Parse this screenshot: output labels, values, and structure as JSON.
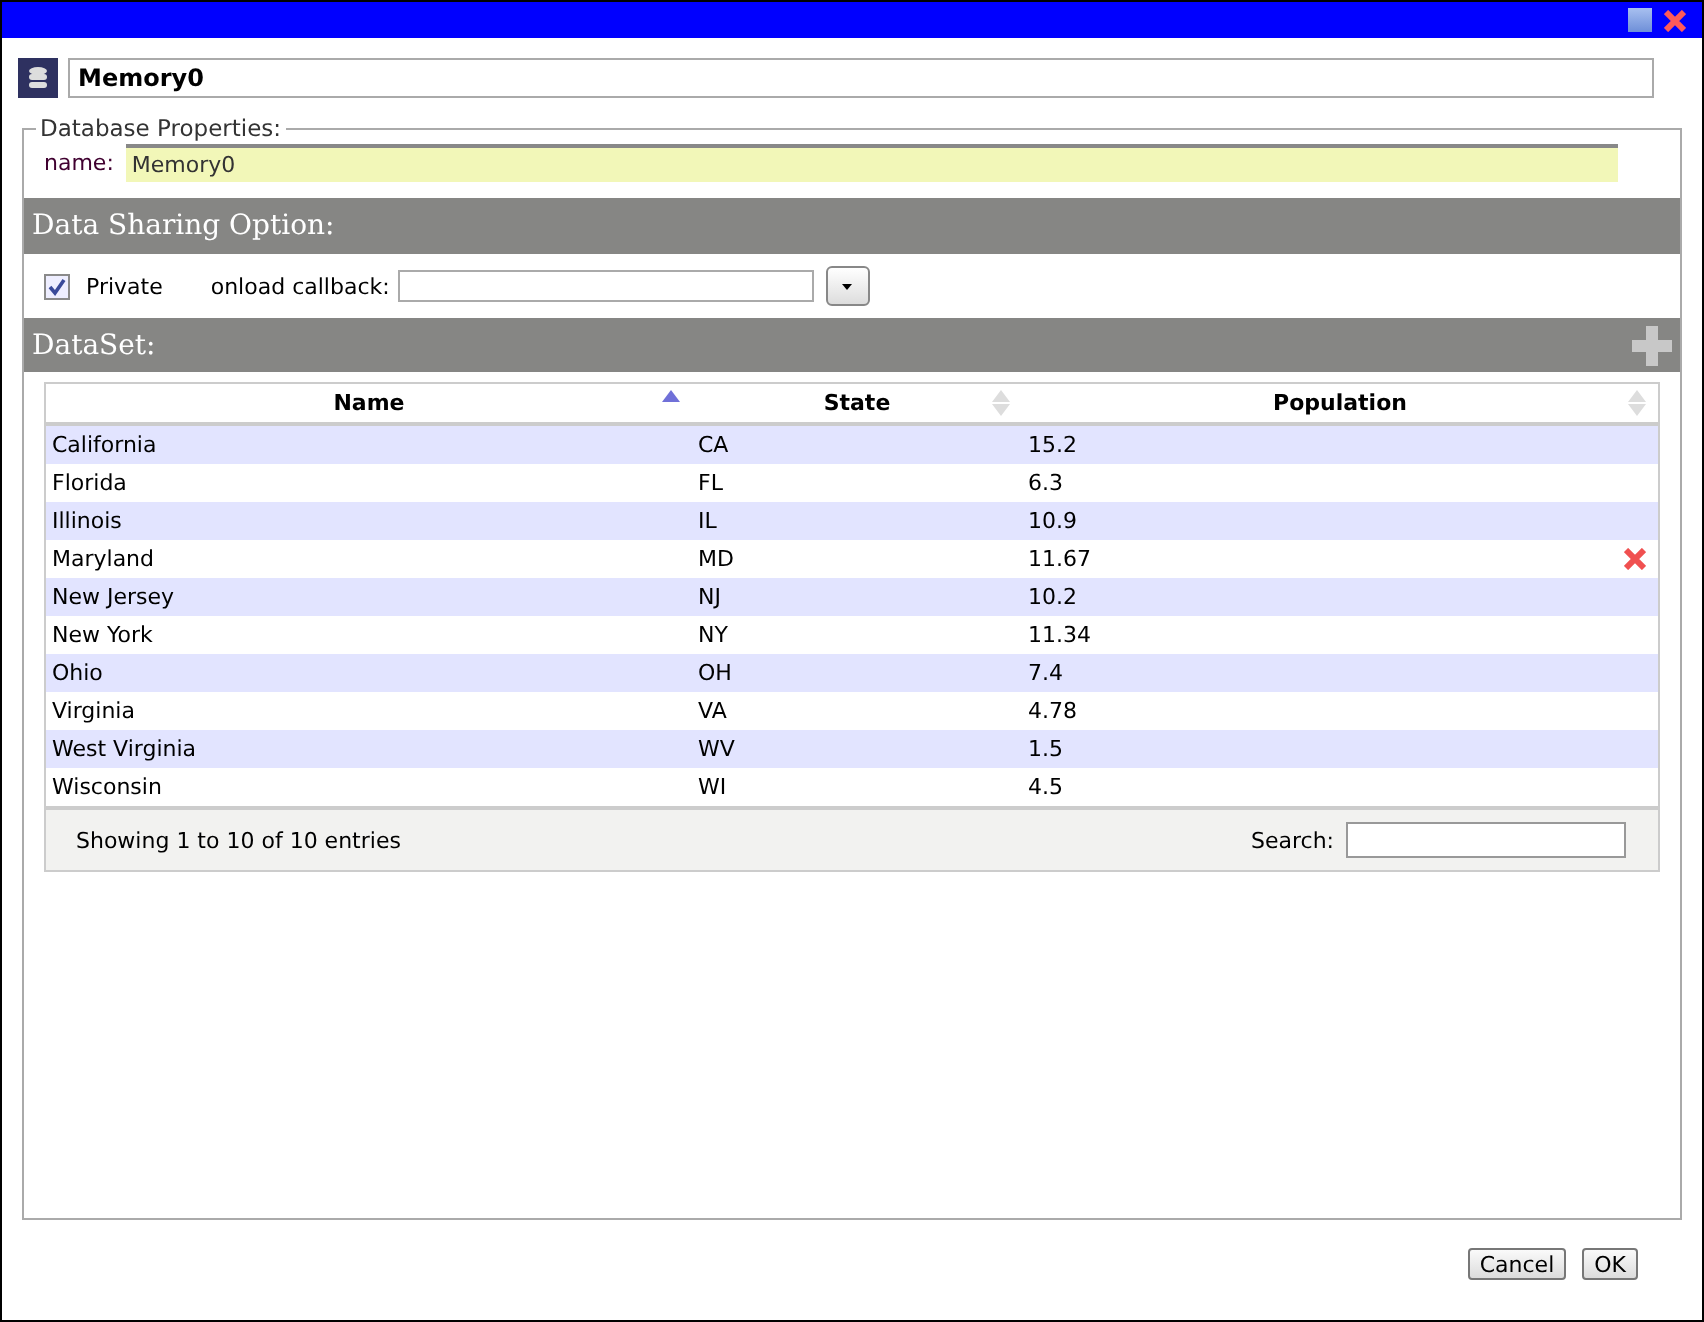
{
  "window": {
    "title_value": "Memory0"
  },
  "database_properties": {
    "legend": "Database Properties:",
    "name_label": "name:",
    "name_value": "Memory0"
  },
  "sharing": {
    "header": "Data Sharing Option:",
    "private_label": "Private",
    "private_checked": true,
    "callback_label": "onload callback:"
  },
  "dataset": {
    "header": "DataSet:",
    "columns": [
      {
        "label": "Name",
        "sorted": true
      },
      {
        "label": "State",
        "sorted": false
      },
      {
        "label": "Population",
        "sorted": false
      }
    ],
    "rows": [
      {
        "cells": [
          "California",
          "CA",
          "15.2"
        ],
        "hovered": false
      },
      {
        "cells": [
          "Florida",
          "FL",
          "6.3"
        ],
        "hovered": false
      },
      {
        "cells": [
          "Illinois",
          "IL",
          "10.9"
        ],
        "hovered": false
      },
      {
        "cells": [
          "Maryland",
          "MD",
          "11.67"
        ],
        "hovered": true
      },
      {
        "cells": [
          "New Jersey",
          "NJ",
          "10.2"
        ],
        "hovered": false
      },
      {
        "cells": [
          "New York",
          "NY",
          "11.34"
        ],
        "hovered": false
      },
      {
        "cells": [
          "Ohio",
          "OH",
          "7.4"
        ],
        "hovered": false
      },
      {
        "cells": [
          "Virginia",
          "VA",
          "4.78"
        ],
        "hovered": false
      },
      {
        "cells": [
          "West Virginia",
          "WV",
          "1.5"
        ],
        "hovered": false
      },
      {
        "cells": [
          "Wisconsin",
          "WI",
          "4.5"
        ],
        "hovered": false
      }
    ],
    "info": "Showing 1 to 10 of 10 entries",
    "search_label": "Search:"
  },
  "buttons": [
    "Cancel",
    "OK"
  ]
}
